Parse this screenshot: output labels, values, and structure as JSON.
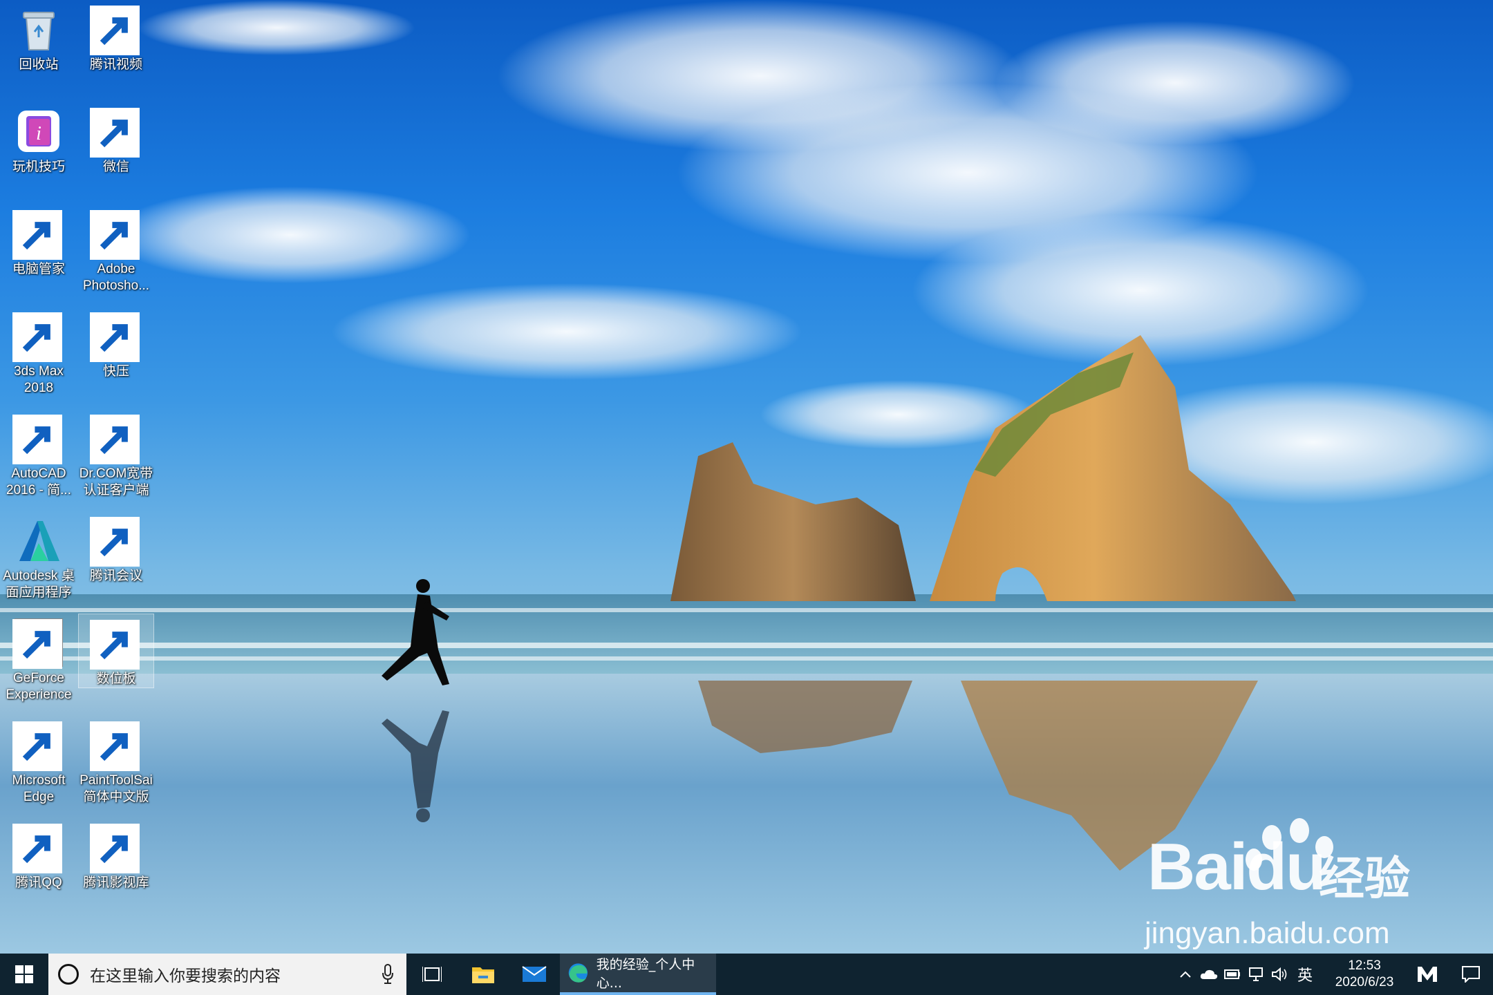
{
  "desktop": {
    "icons": [
      {
        "label": "回收站",
        "icon": "recycle-bin-icon",
        "selected": false
      },
      {
        "label": "腾讯视频",
        "icon": "tencent-video-icon",
        "selected": false
      },
      {
        "label": "玩机技巧",
        "icon": "tips-icon",
        "selected": false
      },
      {
        "label": "微信",
        "icon": "wechat-icon",
        "selected": false
      },
      {
        "label": "电脑管家",
        "icon": "pc-manager-icon",
        "selected": false
      },
      {
        "label": "Adobe\nPhotosho...",
        "icon": "photoshop-icon",
        "selected": false
      },
      {
        "label": "3ds Max\n2018",
        "icon": "3dsmax-icon",
        "selected": false
      },
      {
        "label": "快压",
        "icon": "kuaiya-icon",
        "selected": false
      },
      {
        "label": "AutoCAD\n2016 - 简...",
        "icon": "autocad-icon",
        "selected": false
      },
      {
        "label": "Dr.COM宽带\n认证客户端",
        "icon": "drcom-icon",
        "selected": false
      },
      {
        "label": "Autodesk 桌\n面应用程序",
        "icon": "autodesk-icon",
        "selected": false
      },
      {
        "label": "腾讯会议",
        "icon": "tencent-meeting-icon",
        "selected": false
      },
      {
        "label": "GeForce\nExperience",
        "icon": "geforce-icon",
        "selected": false
      },
      {
        "label": "数位板",
        "icon": "tablet-icon",
        "selected": true
      },
      {
        "label": "Microsoft\nEdge",
        "icon": "edge-icon",
        "selected": false
      },
      {
        "label": "PaintToolSai\n简体中文版",
        "icon": "painttoolsai-icon",
        "selected": false
      },
      {
        "label": "腾讯QQ",
        "icon": "qq-icon",
        "selected": false
      },
      {
        "label": "腾讯影视库",
        "icon": "tencent-video-library-icon",
        "selected": false
      }
    ]
  },
  "watermark": {
    "brand": "Bai",
    "brand_suffix": "du",
    "cn": "经验",
    "url": "jingyan.baidu.com"
  },
  "taskbar": {
    "search_placeholder": "在这里输入你要搜索的内容",
    "edge_window_title": "我的经验_个人中心...",
    "ime": "英",
    "time": "12:53",
    "date": "2020/6/23"
  },
  "colors": {
    "taskbar_bg": "#0f2330",
    "accent": "#6fb4f0"
  }
}
